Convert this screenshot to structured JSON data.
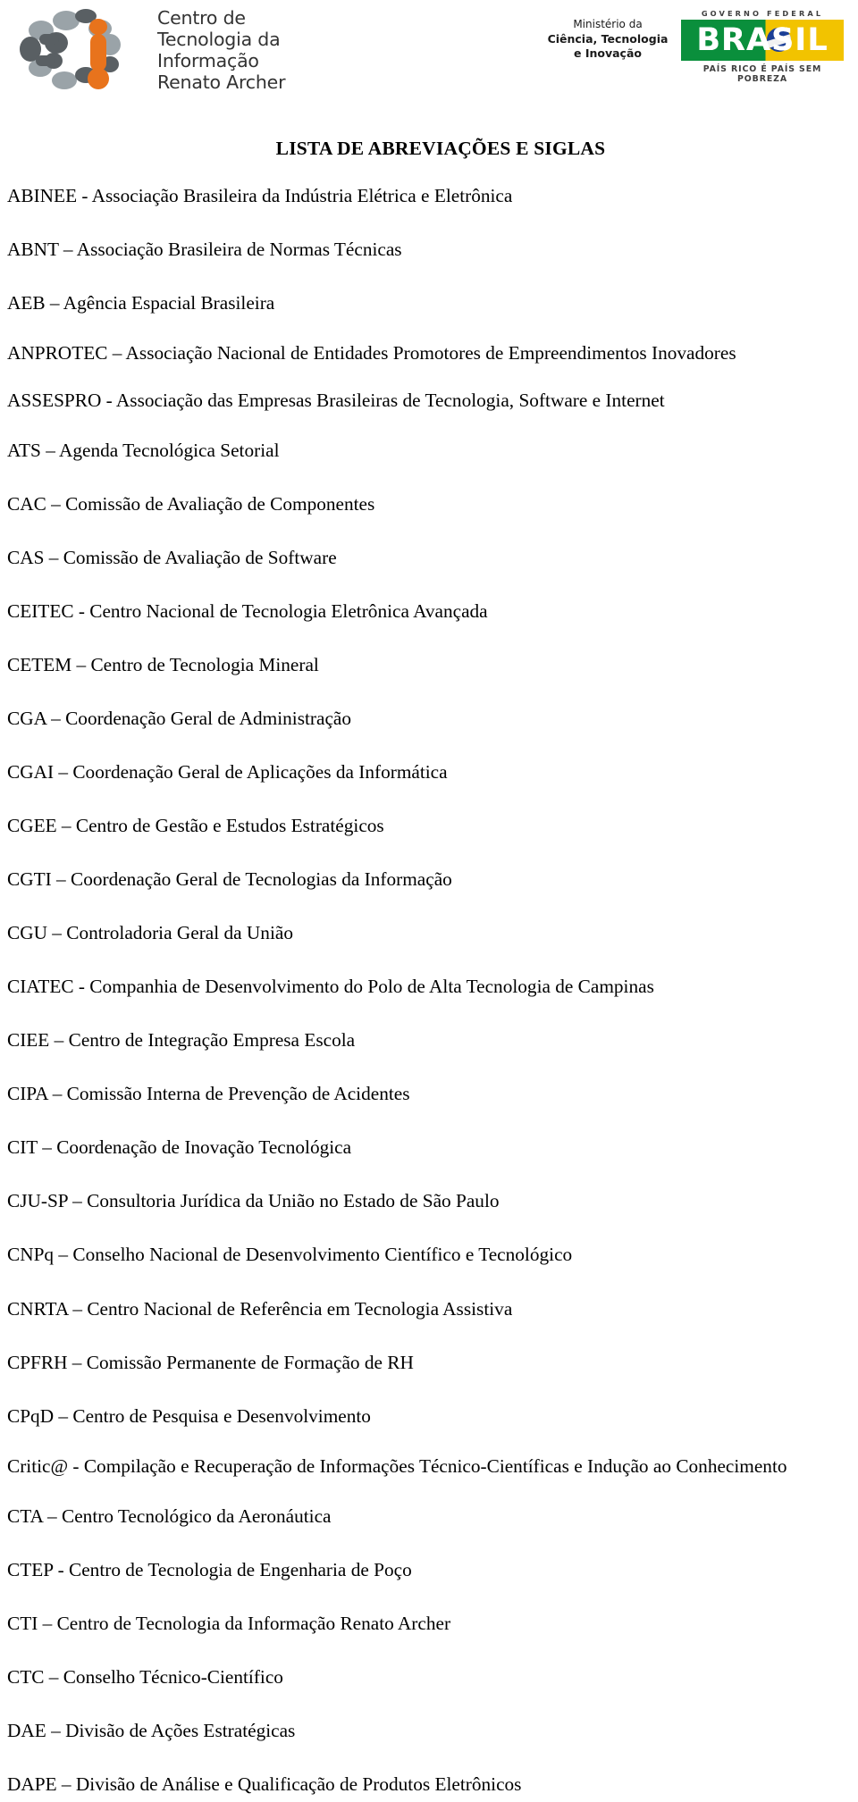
{
  "header": {
    "institution_logo": {
      "icon": "cti-molecule-logo",
      "wordmark": "Centro de\nTecnologia da\nInformação\nRenato Archer"
    },
    "ministry": {
      "line1": "Ministério da",
      "line2": "Ciência, Tecnologia",
      "line3": "e Inovação"
    },
    "government": {
      "top_label": "GOVERNO FEDERAL",
      "brand": "BRASIL",
      "slogan": "PAÍS RICO É PAÍS SEM POBREZA"
    }
  },
  "document": {
    "title": "LISTA DE ABREVIAÇÕES E SIGLAS",
    "entries": [
      "ABINEE - Associação Brasileira da Indústria Elétrica e Eletrônica",
      "ABNT – Associação Brasileira de Normas Técnicas",
      "AEB – Agência Espacial Brasileira",
      "ANPROTEC – Associação Nacional de Entidades Promotores de Empreendimentos Inovadores",
      "ASSESPRO - Associação das Empresas Brasileiras de Tecnologia, Software e Internet",
      "ATS – Agenda Tecnológica Setorial",
      "CAC – Comissão de Avaliação de Componentes",
      "CAS – Comissão de Avaliação de Software",
      "CEITEC - Centro Nacional de Tecnologia Eletrônica Avançada",
      "CETEM – Centro de Tecnologia Mineral",
      "CGA – Coordenação Geral de Administração",
      "CGAI – Coordenação Geral de Aplicações da Informática",
      "CGEE – Centro de Gestão e Estudos Estratégicos",
      "CGTI – Coordenação Geral de Tecnologias da Informação",
      "CGU – Controladoria Geral da União",
      "CIATEC - Companhia de Desenvolvimento do Polo de Alta Tecnologia de Campinas",
      "CIEE – Centro de Integração Empresa Escola",
      "CIPA – Comissão Interna de Prevenção de Acidentes",
      "CIT – Coordenação de Inovação Tecnológica",
      "CJU-SP – Consultoria Jurídica da União no Estado de São Paulo",
      "CNPq – Conselho Nacional de Desenvolvimento Científico e Tecnológico",
      "CNRTA – Centro Nacional de Referência em Tecnologia Assistiva",
      "CPFRH – Comissão Permanente de Formação de RH",
      "CPqD – Centro de Pesquisa e Desenvolvimento",
      "Critic@ - Compilação e Recuperação de Informações Técnico-Científicas e Indução ao Conhecimento",
      "CTA – Centro Tecnológico da Aeronáutica",
      "CTEP - Centro de Tecnologia de Engenharia de Poço",
      "CTI – Centro de Tecnologia da Informação Renato Archer",
      "CTC – Conselho Técnico-Científico",
      "DAE – Divisão de Ações Estratégicas",
      "DAPE – Divisão de Análise e Qualificação de Produtos Eletrônicos"
    ]
  },
  "colors": {
    "text": "#000000",
    "logo_gray_dark": "#595f63",
    "logo_gray_light": "#9aa3a8",
    "logo_orange": "#e8731c",
    "flag_green": "#0a8f3c",
    "flag_yellow": "#f2c300",
    "flag_blue": "#1b3f96"
  }
}
